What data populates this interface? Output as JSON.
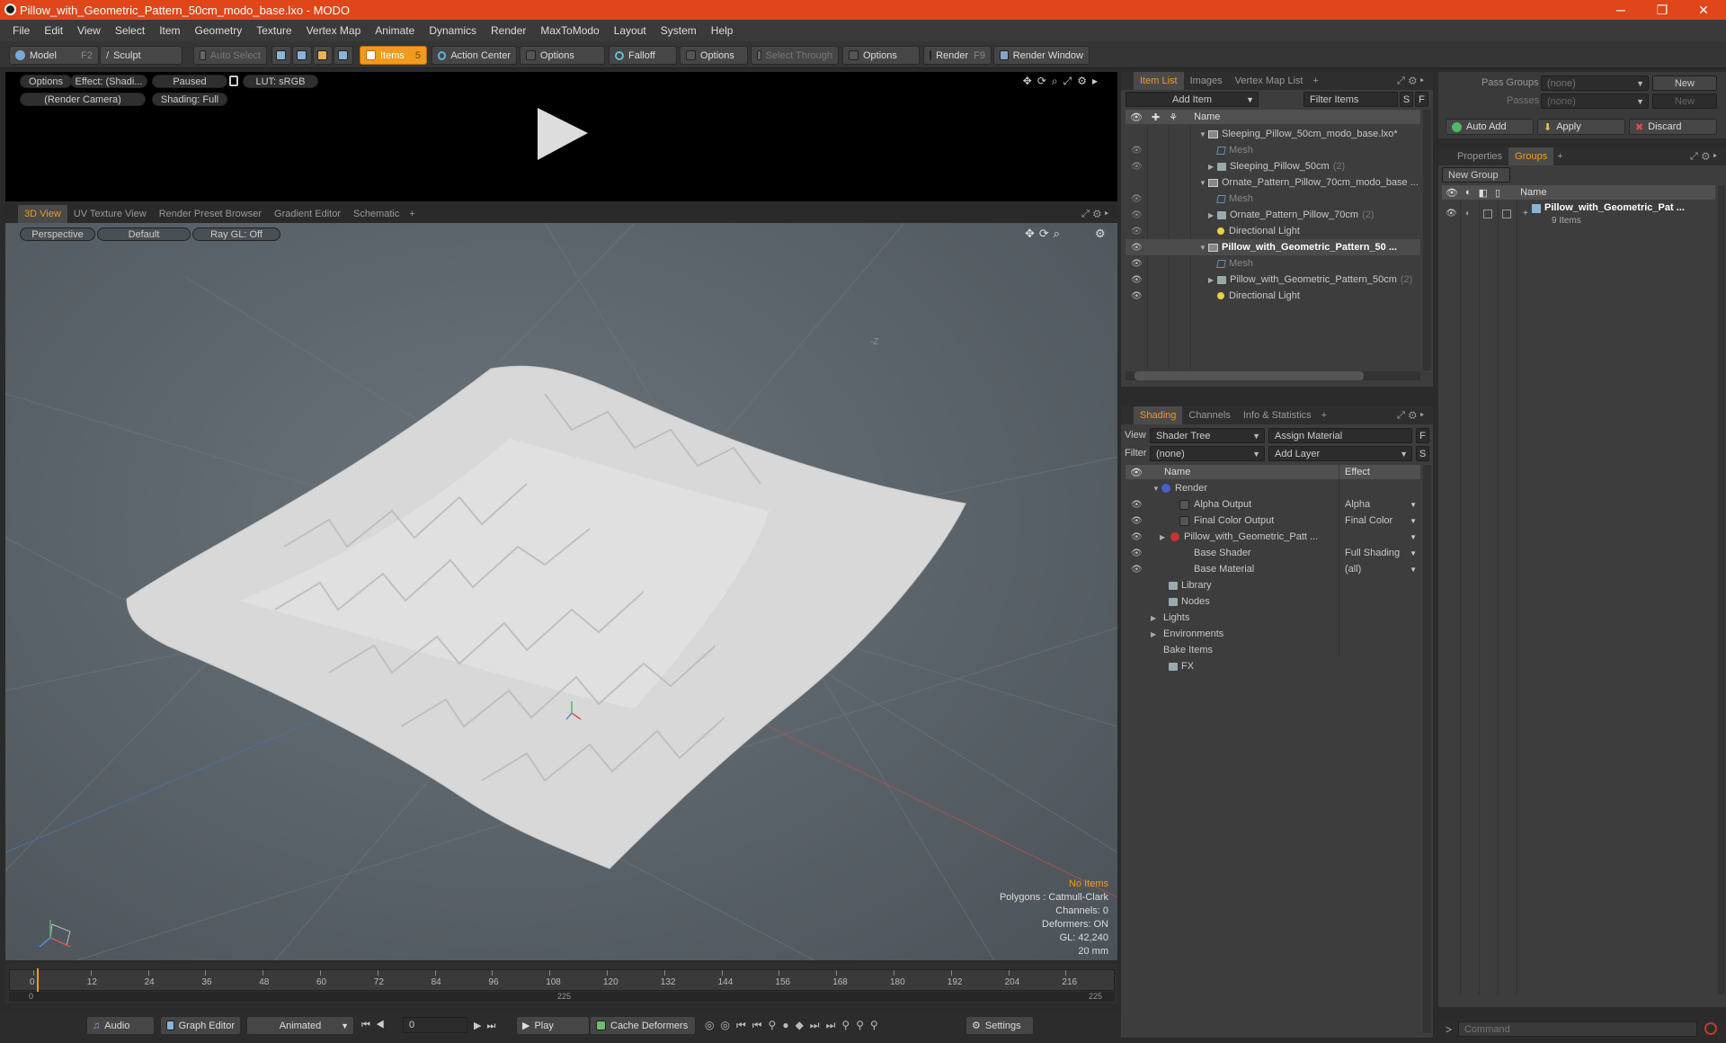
{
  "window": {
    "title": "Pillow_with_Geometric_Pattern_50cm_modo_base.lxo - MODO",
    "minimize": "─",
    "restore": "❐",
    "close": "✕"
  },
  "menu": [
    "File",
    "Edit",
    "View",
    "Select",
    "Item",
    "Geometry",
    "Texture",
    "Vertex Map",
    "Animate",
    "Dynamics",
    "Render",
    "MaxToModo",
    "Layout",
    "System",
    "Help"
  ],
  "toolbar": {
    "model": "Model",
    "model_key": "F2",
    "sculpt": "Sculpt",
    "auto_select": "Auto Select",
    "items": "Items",
    "items_key": "5",
    "action_center": "Action Center",
    "options1": "Options",
    "falloff": "Falloff",
    "options2": "Options",
    "select_through": "Select Through",
    "options3": "Options",
    "render": "Render",
    "render_key": "F9",
    "render_window": "Render Window"
  },
  "preview": {
    "options": "Options",
    "effect": "Effect: (Shadi...",
    "paused": "Paused",
    "lut": "LUT: sRGB",
    "camera": "(Render Camera)",
    "shading": "Shading: Full"
  },
  "viewport": {
    "tabs": [
      "3D View",
      "UV Texture View",
      "Render Preset Browser",
      "Gradient Editor",
      "Schematic"
    ],
    "active_tab": "3D View",
    "perspective": "Perspective",
    "default": "Default",
    "raygl": "Ray GL: Off",
    "axis_label": "-Z",
    "stats": {
      "no_items": "No Items",
      "polygons": "Polygons : Catmull-Clark",
      "channels": "Channels: 0",
      "deformers": "Deformers: ON",
      "gl": "GL: 42,240",
      "scale": "20 mm"
    }
  },
  "timeline": {
    "ticks": [
      "0",
      "12",
      "24",
      "36",
      "48",
      "60",
      "72",
      "84",
      "96",
      "108",
      "120",
      "132",
      "144",
      "156",
      "168",
      "180",
      "192",
      "204",
      "216"
    ],
    "sub_left": "0",
    "sub_mid": "225",
    "sub_right": "225"
  },
  "bottombar": {
    "audio": "Audio",
    "graph_editor": "Graph Editor",
    "animated": "Animated",
    "frame": "0",
    "play": "Play",
    "cache": "Cache Deformers",
    "settings": "Settings"
  },
  "itemlist": {
    "tabs": [
      "Item List",
      "Images",
      "Vertex Map List"
    ],
    "active_tab": "Item List",
    "add_item": "Add Item",
    "filter": "Filter Items",
    "s": "S",
    "f": "F",
    "col_name": "Name",
    "rows": [
      {
        "label": "Sleeping_Pillow_50cm_modo_base.lxo*",
        "count": ""
      },
      {
        "label": "Mesh",
        "count": ""
      },
      {
        "label": "Sleeping_Pillow_50cm",
        "count": "(2)"
      },
      {
        "label": "Ornate_Pattern_Pillow_70cm_modo_base ...",
        "count": ""
      },
      {
        "label": "Mesh",
        "count": ""
      },
      {
        "label": "Ornate_Pattern_Pillow_70cm",
        "count": "(2)"
      },
      {
        "label": "Directional Light",
        "count": ""
      },
      {
        "label": "Pillow_with_Geometric_Pattern_50 ...",
        "count": ""
      },
      {
        "label": "Mesh",
        "count": ""
      },
      {
        "label": "Pillow_with_Geometric_Pattern_50cm",
        "count": "(2)"
      },
      {
        "label": "Directional Light",
        "count": ""
      }
    ]
  },
  "shading": {
    "tabs": [
      "Shading",
      "Channels",
      "Info & Statistics"
    ],
    "active_tab": "Shading",
    "view_label": "View",
    "view_value": "Shader Tree",
    "assign": "Assign Material",
    "f": "F",
    "filter_label": "Filter",
    "filter_value": "(none)",
    "add_layer": "Add Layer",
    "s": "S",
    "col_name": "Name",
    "col_effect": "Effect",
    "rows": [
      {
        "label": "Render",
        "effect": ""
      },
      {
        "label": "Alpha Output",
        "effect": "Alpha"
      },
      {
        "label": "Final Color Output",
        "effect": "Final Color"
      },
      {
        "label": "Pillow_with_Geometric_Patt ...",
        "effect": ""
      },
      {
        "label": "Base Shader",
        "effect": "Full Shading"
      },
      {
        "label": "Base Material",
        "effect": "(all)"
      },
      {
        "label": "Library",
        "effect": ""
      },
      {
        "label": "Nodes",
        "effect": ""
      },
      {
        "label": "Lights",
        "effect": ""
      },
      {
        "label": "Environments",
        "effect": ""
      },
      {
        "label": "Bake Items",
        "effect": ""
      },
      {
        "label": "FX",
        "effect": ""
      }
    ]
  },
  "passes": {
    "pass_groups": "Pass Groups",
    "passes": "Passes",
    "none": "(none)",
    "new": "New",
    "auto_add": "Auto Add",
    "apply": "Apply",
    "discard": "Discard"
  },
  "groups": {
    "tabs": [
      "Properties",
      "Groups"
    ],
    "active_tab": "Groups",
    "new_group": "New Group",
    "col_name": "Name",
    "item_name": "Pillow_with_Geometric_Pat ...",
    "item_sub": "9 Items"
  },
  "command": {
    "placeholder": "Command"
  },
  "colors": {
    "accent": "#f29a1f",
    "titlebar": "#e0461a"
  }
}
